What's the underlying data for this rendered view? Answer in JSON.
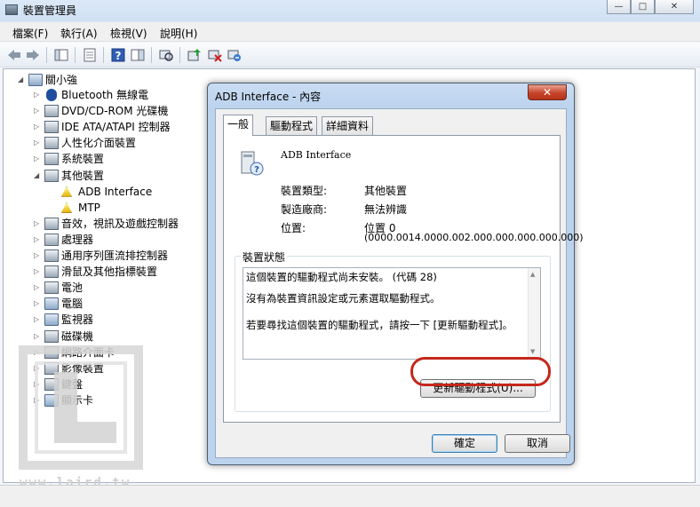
{
  "main_window": {
    "title": "裝置管理員",
    "window_controls": [
      "—",
      "□",
      "✕"
    ],
    "menu": [
      "檔案(F)",
      "執行(A)",
      "檢視(V)",
      "說明(H)"
    ]
  },
  "tree": {
    "root": "關小強",
    "items": [
      {
        "label": "Bluetooth 無線電",
        "icon": "bluetooth-icon",
        "level": 1
      },
      {
        "label": "DVD/CD-ROM 光碟機",
        "icon": "dvd-drive-icon",
        "level": 1
      },
      {
        "label": "IDE ATA/ATAPI 控制器",
        "icon": "ide-controller-icon",
        "level": 1
      },
      {
        "label": "人性化介面裝置",
        "icon": "hid-icon",
        "level": 1
      },
      {
        "label": "系統裝置",
        "icon": "system-device-icon",
        "level": 1
      },
      {
        "label": "其他裝置",
        "icon": "other-device-icon",
        "level": 1,
        "expanded": true
      },
      {
        "label": "ADB Interface",
        "icon": "warning-device-icon",
        "level": 2
      },
      {
        "label": "MTP",
        "icon": "warning-device-icon",
        "level": 2
      },
      {
        "label": "音效，視訊及遊戲控制器",
        "icon": "sound-icon",
        "level": 1
      },
      {
        "label": "處理器",
        "icon": "processor-icon",
        "level": 1
      },
      {
        "label": "通用序列匯流排控制器",
        "icon": "usb-controller-icon",
        "level": 1
      },
      {
        "label": "滑鼠及其他指標裝置",
        "icon": "mouse-icon",
        "level": 1
      },
      {
        "label": "電池",
        "icon": "battery-icon",
        "level": 1
      },
      {
        "label": "電腦",
        "icon": "computer-icon",
        "level": 1
      },
      {
        "label": "監視器",
        "icon": "monitor-icon",
        "level": 1
      },
      {
        "label": "磁碟機",
        "icon": "disk-drive-icon",
        "level": 1
      },
      {
        "label": "網路介面卡",
        "icon": "network-adapter-icon",
        "level": 1
      },
      {
        "label": "影像裝置",
        "icon": "imaging-device-icon",
        "level": 1
      },
      {
        "label": "鍵盤",
        "icon": "keyboard-icon",
        "level": 1
      },
      {
        "label": "顯示卡",
        "icon": "display-adapter-icon",
        "level": 1
      }
    ]
  },
  "watermark": {
    "text": "www.laird.tw"
  },
  "dialog": {
    "title": "ADB Interface - 內容",
    "close_label": "✕",
    "tabs": [
      "一般",
      "驅動程式",
      "詳細資料"
    ],
    "device_name": "ADB Interface",
    "properties": [
      {
        "label": "裝置類型:",
        "value": "其他裝置"
      },
      {
        "label": "製造廠商:",
        "value": "無法辨識"
      },
      {
        "label": "位置:",
        "value": "位置 0",
        "value2": "(0000.0014.0000.002.000.000.000.000.000)"
      }
    ],
    "status_group_title": "裝置狀態",
    "status_lines": [
      "這個裝置的驅動程式尚未安裝。 (代碼 28)",
      "沒有為裝置資訊設定或元素選取驅動程式。",
      "",
      "若要尋找這個裝置的驅動程式，請按一下 [更新驅動程式]。"
    ],
    "update_driver_button": "更新驅動程式(U)...",
    "ok_button": "確定",
    "cancel_button": "取消"
  },
  "colors": {
    "highlight": "#c4281c",
    "dialog_frame": "#bcd3ee"
  }
}
